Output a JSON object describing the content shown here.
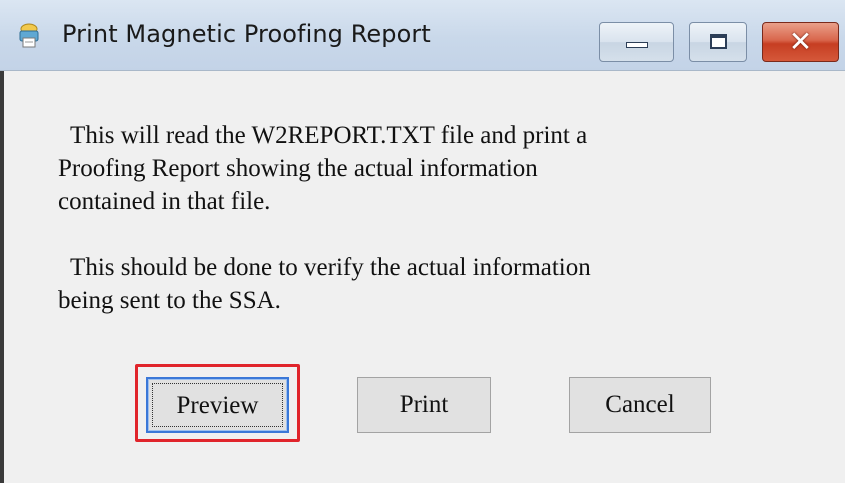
{
  "window": {
    "title": "Print Magnetic Proofing Report",
    "icon": "printer-app-icon",
    "controls": {
      "minimize": "minimize-icon",
      "maximize": "maximize-icon",
      "close_glyph": "✕"
    }
  },
  "message": {
    "paragraph1": "  This will read the W2REPORT.TXT file and print a\nProofing Report showing the actual information\ncontained in that file.",
    "paragraph2": "  This should be done to verify the actual information\nbeing sent to the SSA."
  },
  "buttons": {
    "preview": "Preview",
    "print": "Print",
    "cancel": "Cancel"
  },
  "colors": {
    "highlight": "#e0242b",
    "focus_border": "#3b78d8",
    "close_button": "#c63e22"
  }
}
